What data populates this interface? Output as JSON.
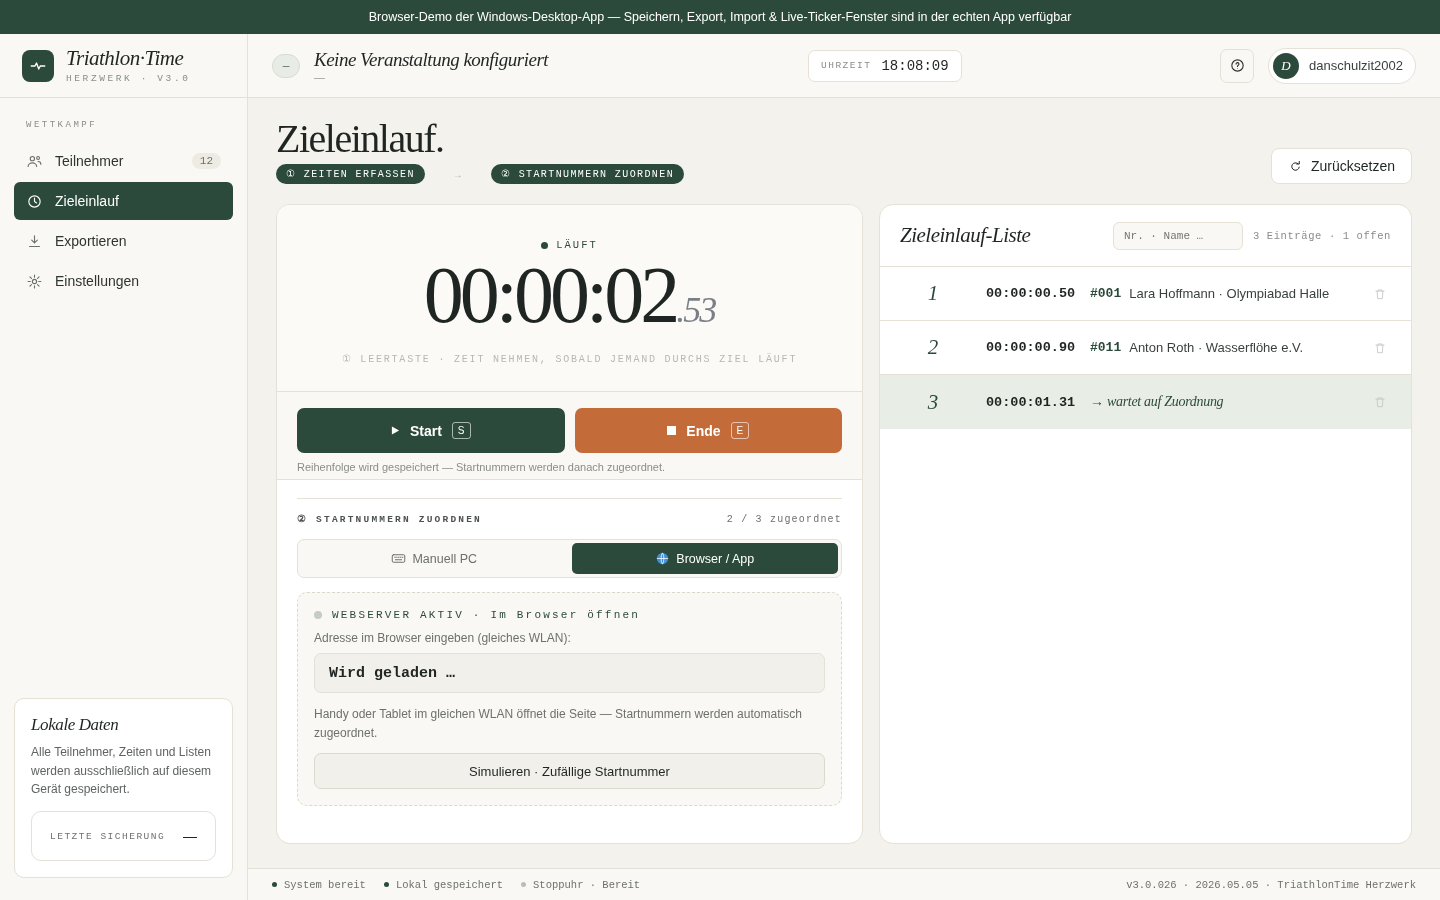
{
  "banner": "Browser-Demo der Windows-Desktop-App — Speichern, Export, Import & Live-Ticker-Fenster sind in der echten App verfügbar",
  "brand": {
    "name": "Triathlon·Time",
    "sub": "HERZWERK · V3.0"
  },
  "header": {
    "event_badge": "–",
    "event_title": "Keine Veranstaltung konfiguriert",
    "event_sub": "—",
    "clock_label": "UHRZEIT",
    "clock": "18:08:09",
    "user_initial": "D",
    "user_name": "danschulzit2002"
  },
  "sidebar": {
    "section": "WETTKAMPF",
    "items": [
      {
        "label": "Teilnehmer",
        "badge": "12",
        "selected": false
      },
      {
        "label": "Zieleinlauf",
        "selected": true
      },
      {
        "label": "Exportieren",
        "selected": false
      },
      {
        "label": "Einstellungen",
        "selected": false
      }
    ],
    "card": {
      "title": "Lokale Daten",
      "text": "Alle Teilnehmer, Zeiten und Listen werden ausschließlich auf diesem Gerät gespeichert.",
      "backup_label": "LETZTE SICHERUNG",
      "backup_value": "—"
    }
  },
  "page": {
    "title": "Zieleinlauf.",
    "steps": [
      "① ZEITEN ERFASSEN",
      "② STARTNUMMERN ZUORDNEN"
    ],
    "step_arrow": "→",
    "reset": "Zurücksetzen"
  },
  "stopwatch": {
    "status": "LÄUFT",
    "time": "00:00:02",
    "fraction": ".53",
    "hint": "① LEERTASTE · ZEIT NEHMEN, SOBALD JEMAND DURCHS ZIEL LÄUFT",
    "buttons": [
      {
        "kind": "start",
        "label": "Start",
        "key": "S"
      },
      {
        "kind": "stop",
        "label": "Ende",
        "key": "E"
      }
    ],
    "note": "Reihenfolge wird gespeichert — Startnummern werden danach zugeordnet."
  },
  "assign": {
    "title": "② STARTNUMMERN ZUORDNEN",
    "count": "2 / 3 zugeordnet",
    "tabs": [
      {
        "label": "Manuell PC",
        "selected": false
      },
      {
        "label": "Browser / App",
        "selected": true
      }
    ],
    "server": {
      "status": "WEBSERVER AKTIV · Im Browser öffnen",
      "active": false,
      "label": "Adresse im Browser eingeben (gleiches WLAN):",
      "address": "Wird geladen …",
      "text": "Handy oder Tablet im gleichen WLAN öffnet die Seite — Startnummern werden automatisch zugeordnet.",
      "button": "Simulieren · Zufällige Startnummer"
    }
  },
  "finish_list": {
    "title": "Zieleinlauf-Liste",
    "search_placeholder": "Nr. · Name …",
    "summary": "3 Einträge · 1 offen",
    "rows": [
      {
        "place": "1",
        "time": "00:00:00.50",
        "kind": "assigned",
        "bib": "#001",
        "name": "Lara Hoffmann · Olympiabad Halle"
      },
      {
        "place": "2",
        "time": "00:00:00.90",
        "kind": "assigned",
        "bib": "#011",
        "name": "Anton Roth · Wasserflöhe e.V."
      },
      {
        "place": "3",
        "time": "00:00:01.31",
        "kind": "pending",
        "name": "→ wartet auf Zuordnung"
      }
    ]
  },
  "status_bar": {
    "items": [
      {
        "label": "System bereit",
        "color": "#2c4a3b"
      },
      {
        "label": "Lokal gespeichert",
        "color": "#2c4a3b"
      },
      {
        "label": "Stoppuhr · Bereit",
        "color": "#bdbdb8"
      }
    ],
    "version": "v3.0.026 · 2026.05.05 · TriathlonTime Herzwerk"
  }
}
